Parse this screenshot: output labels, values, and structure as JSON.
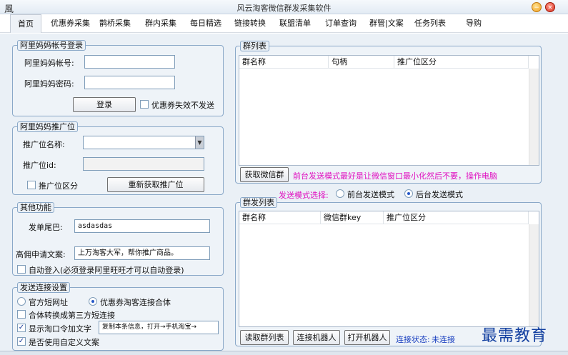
{
  "window": {
    "title": "风云淘客微信群发采集软件",
    "app_icon_glyph": "風"
  },
  "menu": {
    "items": [
      "首页",
      "优惠券采集",
      "鹊桥采集",
      "群内采集",
      "每日精选",
      "链接转换",
      "联盟清单",
      "订单查询",
      "群管|文案",
      "任务列表",
      "导购"
    ]
  },
  "login": {
    "title": "阿里妈妈帐号登录",
    "account_label": "阿里妈妈帐号:",
    "account_value": "",
    "password_label": "阿里妈妈密码:",
    "password_value": "",
    "login_button": "登录",
    "coupon_invalid_label": "优惠券失效不发送"
  },
  "promo": {
    "title": "阿里妈妈推广位",
    "name_label": "推广位名称:",
    "name_value": "",
    "id_label": "推广位id:",
    "id_value": "",
    "distinguish_label": "推广位区分",
    "refresh_button": "重新获取推广位"
  },
  "other": {
    "title": "其他功能",
    "tail_label": "发单尾巴:",
    "tail_value": "asdasdas",
    "apply_label": "高佣申请文案:",
    "apply_value": "上万淘客大军，帮你推广商品。",
    "auto_login_label": "自动登入(必须登录阿里旺旺才可以自动登录)"
  },
  "send_settings": {
    "title": "发送连接设置",
    "radio_official": "官方短网址",
    "radio_combined": "优惠券淘客连接合体",
    "merge_label": "合体转换成第三方短连接",
    "show_tkl_label": "显示淘口令加文字",
    "tkl_text_value": "复制本条信息，打开→手机淘宝→",
    "custom_copy_label": "是否使用自定义文案"
  },
  "group_list": {
    "title": "群列表",
    "columns": [
      "群名称",
      "句柄",
      "推广位区分"
    ],
    "fetch_button": "获取微信群",
    "notice": "前台发送模式最好是让微信窗口最小化然后不要，操作电脑"
  },
  "send_mode": {
    "label": "发送模式选择:",
    "foreground": "前台发送模式",
    "background": "后台发送模式"
  },
  "mass_list": {
    "title": "群发列表",
    "columns": [
      "群名称",
      "微信群key",
      "推广位区分"
    ],
    "read_button": "读取群列表",
    "connect_button": "连接机器人",
    "open_button": "打开机器人",
    "status_label": "连接状态:",
    "status_value": "未连接"
  },
  "watermark": "最需教育",
  "icons": {
    "check": "✓",
    "dropdown": "▼",
    "minimize": "−",
    "close": "×"
  },
  "colors": {
    "magenta": "#e010c0",
    "status_blue": "#1a40c0",
    "group_border": "#8aa8c8"
  }
}
